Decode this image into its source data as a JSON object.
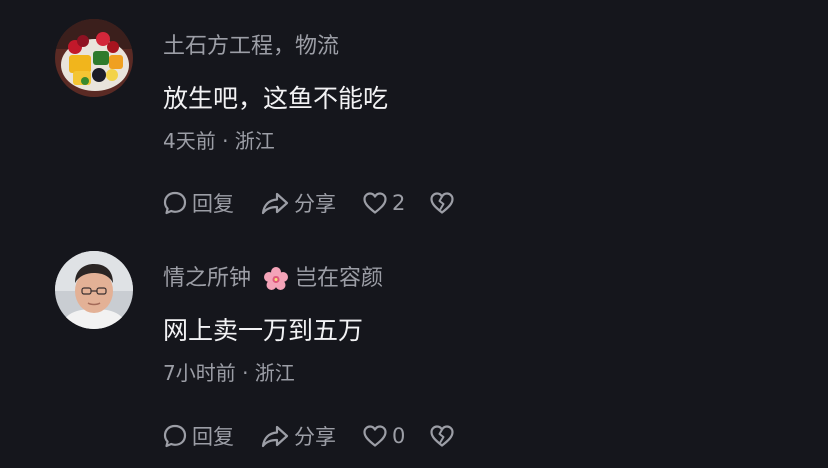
{
  "comments": [
    {
      "username": "土石方工程，物流",
      "badge_text": "",
      "content": "放生吧，这鱼不能吃",
      "meta": "4天前 · 浙江",
      "reply_label": "回复",
      "share_label": "分享",
      "like_count": "2",
      "avatar_icon": "fruit-platter-avatar"
    },
    {
      "username": "情之所钟",
      "badge_text": "岂在容颜",
      "content": "网上卖一万到五万",
      "meta": "7小时前 · 浙江",
      "reply_label": "回复",
      "share_label": "分享",
      "like_count": "0",
      "avatar_icon": "man-portrait-avatar"
    }
  ],
  "colors": {
    "background": "#15161c",
    "primary_text": "#f2f2f4",
    "secondary_text": "#9c9ea6"
  }
}
